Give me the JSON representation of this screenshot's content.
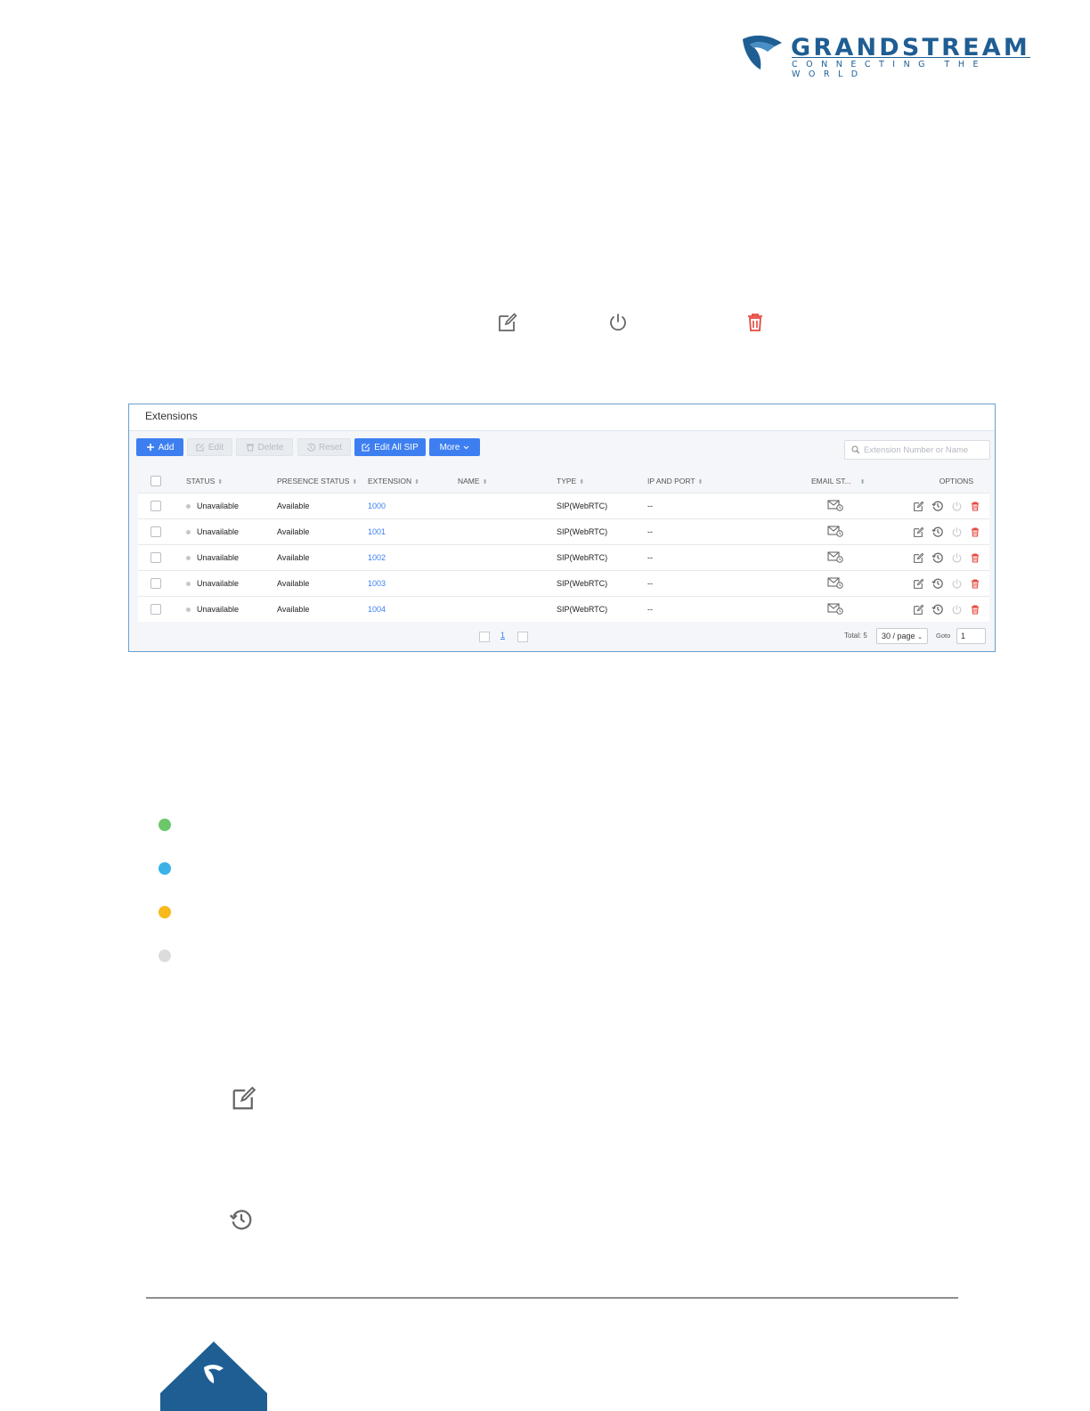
{
  "logo": {
    "brand": "GRANDSTREAM",
    "tagline": "CONNECTING THE WORLD",
    "colors": {
      "primary": "#1f5e93"
    }
  },
  "inline_icons": [
    "edit-icon",
    "power-icon",
    "trash-icon"
  ],
  "panel": {
    "title": "Extensions",
    "toolbar": {
      "add": "Add",
      "edit": "Edit",
      "delete": "Delete",
      "reset": "Reset",
      "edit_all_sip": "Edit All SIP",
      "more": "More"
    },
    "search_placeholder": "Extension Number or Name",
    "columns": [
      "STATUS",
      "PRESENCE STATUS",
      "EXTENSION",
      "NAME",
      "TYPE",
      "IP AND PORT",
      "EMAIL ST...",
      "OPTIONS"
    ],
    "rows": [
      {
        "status": "Unavailable",
        "presence": "Available",
        "extension": "1000",
        "name": "",
        "type": "SIP(WebRTC)",
        "ip_port": "--"
      },
      {
        "status": "Unavailable",
        "presence": "Available",
        "extension": "1001",
        "name": "",
        "type": "SIP(WebRTC)",
        "ip_port": "--"
      },
      {
        "status": "Unavailable",
        "presence": "Available",
        "extension": "1002",
        "name": "",
        "type": "SIP(WebRTC)",
        "ip_port": "--"
      },
      {
        "status": "Unavailable",
        "presence": "Available",
        "extension": "1003",
        "name": "",
        "type": "SIP(WebRTC)",
        "ip_port": "--"
      },
      {
        "status": "Unavailable",
        "presence": "Available",
        "extension": "1004",
        "name": "",
        "type": "SIP(WebRTC)",
        "ip_port": "--"
      }
    ],
    "pagination": {
      "current_page": "1",
      "total": "Total: 5",
      "page_size": "30 / page",
      "goto_label": "Goto",
      "goto_value": "1"
    },
    "colors": {
      "accent": "#3d7ff0",
      "danger": "#e5483f"
    }
  },
  "status_legend": {
    "dot_colors": [
      "#6cc76a",
      "#3bb1e8",
      "#f7b91c",
      "#dcdcdc"
    ]
  },
  "options_icons": [
    "edit-icon",
    "reset-history-icon"
  ]
}
